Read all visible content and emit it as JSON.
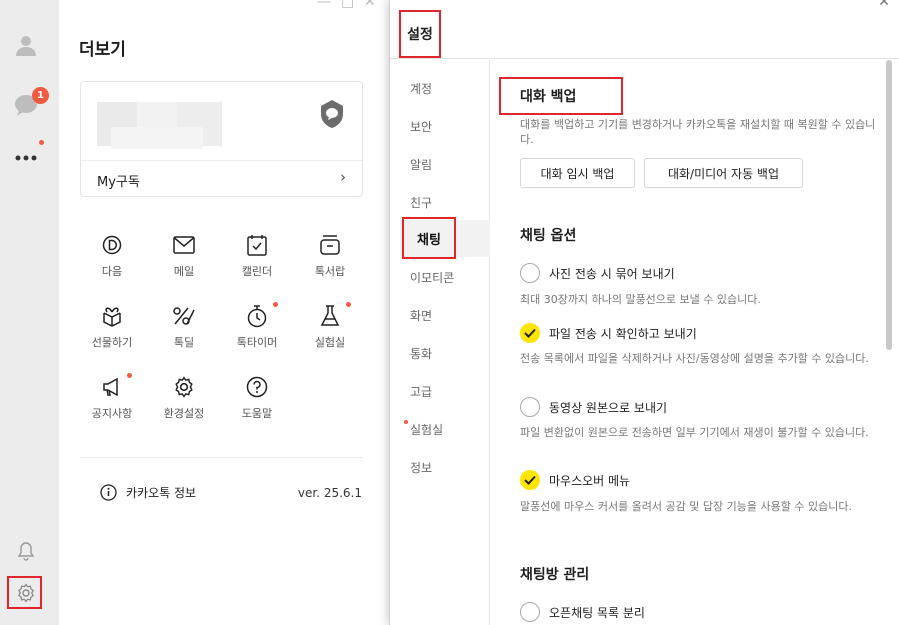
{
  "rail": {
    "badge_count": "1"
  },
  "more": {
    "title": "더보기",
    "my_subscription": "My구독",
    "grid": [
      {
        "label": "다음"
      },
      {
        "label": "메일"
      },
      {
        "label": "캘린더"
      },
      {
        "label": "톡서랍"
      },
      {
        "label": "선물하기"
      },
      {
        "label": "톡딜"
      },
      {
        "label": "톡타이머"
      },
      {
        "label": "실험실"
      },
      {
        "label": "공지사항"
      },
      {
        "label": "환경설정"
      },
      {
        "label": "도움말"
      }
    ],
    "info_label": "카카오톡 정보",
    "version": "ver. 25.6.1"
  },
  "settings": {
    "title": "설정",
    "nav": [
      "계정",
      "보안",
      "알림",
      "친구",
      "채팅",
      "이모티콘",
      "화면",
      "통화",
      "고급",
      "실험실",
      "정보"
    ],
    "backup": {
      "title": "대화 백업",
      "desc": "대화를 백업하고 기기를 변경하거나 카카오톡을 재설치할 때 복원할 수 있습니다.",
      "temp_backup_btn": "대화 임시 백업",
      "auto_backup_btn": "대화/미디어 자동 백업"
    },
    "chat_options": {
      "title": "채팅 옵션",
      "items": [
        {
          "label": "사진 전송 시 묶어 보내기",
          "checked": false,
          "desc": "최대 30장까지 하나의 말풍선으로 보낼 수 있습니다."
        },
        {
          "label": "파일 전송 시 확인하고 보내기",
          "checked": true,
          "desc": "전송 목록에서 파일을 삭제하거나 사진/동영상에 설명을 추가할 수 있습니다."
        },
        {
          "label": "동영상 원본으로 보내기",
          "checked": false,
          "desc": "파일 변환없이 원본으로 전송하면 일부 기기에서 재생이 불가할 수 있습니다."
        },
        {
          "label": "마우스오버 메뉴",
          "checked": true,
          "desc": "말풍선에 마우스 커서를 올려서 공감 및 답장 기능을 사용할 수 있습니다."
        }
      ]
    },
    "room_mgmt": {
      "title": "채팅방 관리",
      "items": [
        {
          "label": "오픈채팅 목록 분리",
          "checked": false
        }
      ]
    }
  },
  "colors": {
    "accent_yellow": "#FEE500",
    "highlight_red": "#E0262B",
    "badge_red": "#F25A42"
  }
}
